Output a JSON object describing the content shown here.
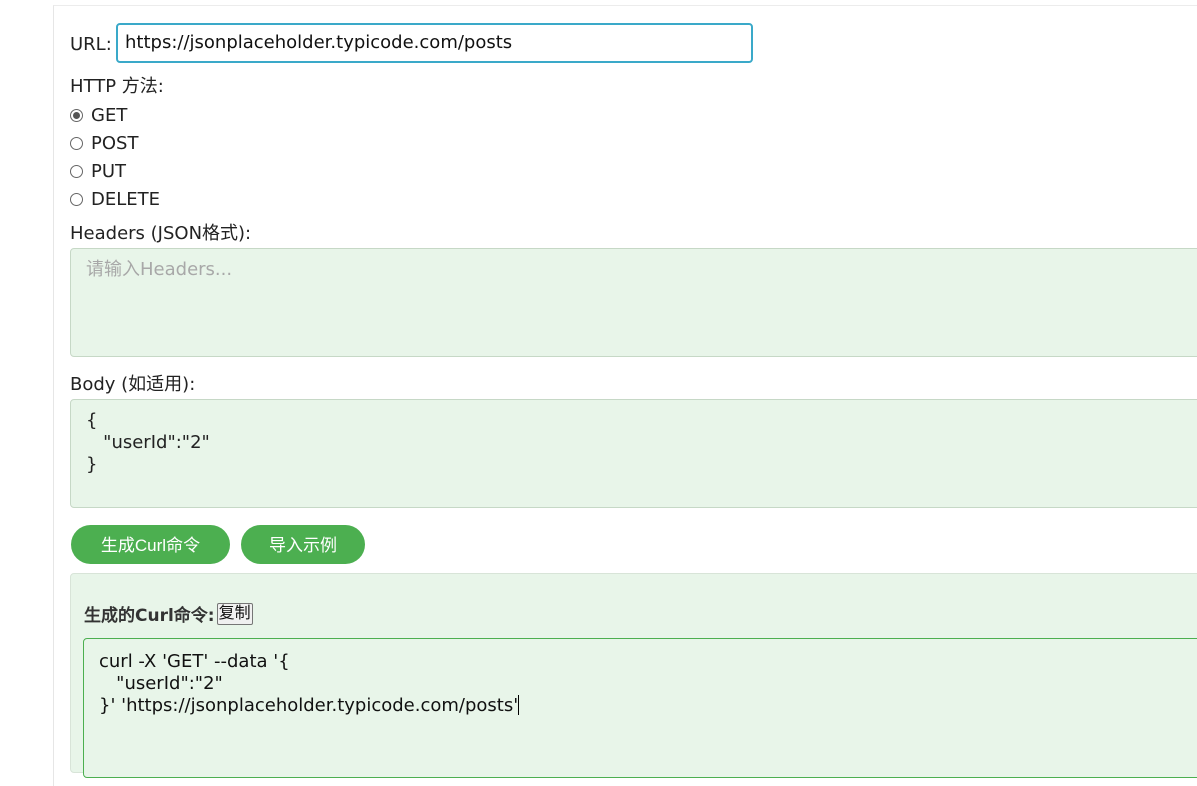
{
  "url": {
    "label": "URL:",
    "value": "https://jsonplaceholder.typicode.com/posts"
  },
  "method": {
    "label": "HTTP 方法:",
    "options": [
      "GET",
      "POST",
      "PUT",
      "DELETE"
    ],
    "selected": "GET"
  },
  "headers": {
    "label": "Headers (JSON格式):",
    "value": "",
    "placeholder": "请输入Headers..."
  },
  "body": {
    "label": "Body (如适用):",
    "value": "{\n   \"userId\":\"2\"\n}"
  },
  "buttons": {
    "generate": "生成Curl命令",
    "import_example": "导入示例"
  },
  "result": {
    "title": "生成的Curl命令:",
    "copy_label": "复制",
    "command": "curl -X 'GET' --data '{\n   \"userId\":\"2\"\n}' 'https://jsonplaceholder.typicode.com/posts'"
  },
  "colors": {
    "accent": "#4caf50",
    "input_focus": "#3aa9c9",
    "panel_bg": "#e8f5e9"
  }
}
